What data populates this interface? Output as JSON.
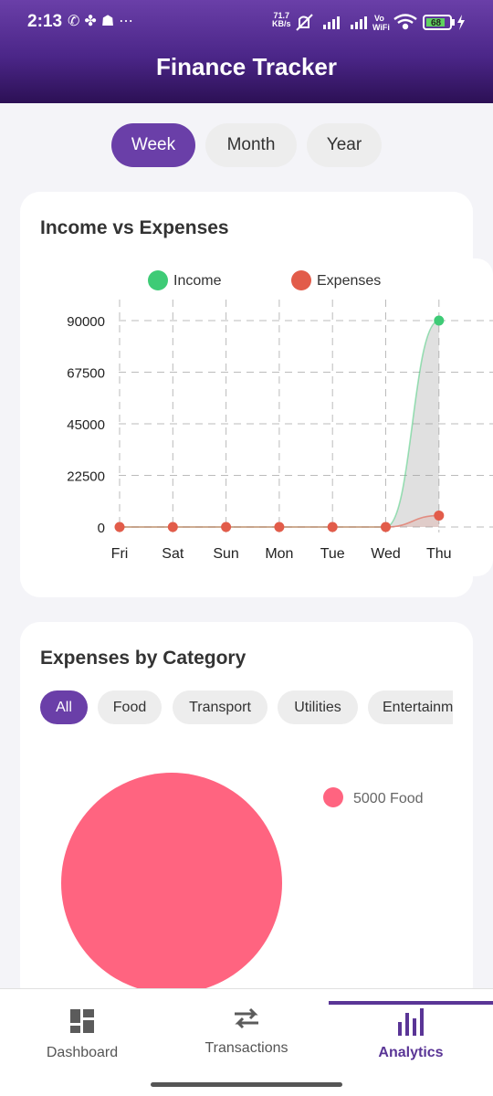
{
  "status_bar": {
    "time": "2:13",
    "left_icons": [
      "whatsapp-icon",
      "pinwheel-icon",
      "snapchat-icon",
      "more-dots-icon"
    ],
    "net_speed_value": "71.7",
    "net_speed_unit": "KB/s",
    "wifi_label": "Vo WiFi",
    "battery_level": "68"
  },
  "header": {
    "title": "Finance Tracker"
  },
  "period_tabs": [
    {
      "label": "Week",
      "active": true
    },
    {
      "label": "Month",
      "active": false
    },
    {
      "label": "Year",
      "active": false
    }
  ],
  "income_chart": {
    "title": "Income vs Expenses",
    "legend": [
      {
        "label": "Income",
        "color": "#3ecb76"
      },
      {
        "label": "Expenses",
        "color": "#e25c4a"
      }
    ]
  },
  "chart_data": [
    {
      "type": "area",
      "title": "Income vs Expenses",
      "categories": [
        "Fri",
        "Sat",
        "Sun",
        "Mon",
        "Tue",
        "Wed",
        "Thu"
      ],
      "y_ticks": [
        "90000",
        "67500",
        "45000",
        "22500",
        "0"
      ],
      "ylim": [
        0,
        90000
      ],
      "grid": true,
      "legend_position": "top",
      "series": [
        {
          "name": "Income",
          "color": "#3ecb76",
          "values": [
            0,
            0,
            0,
            0,
            0,
            0,
            90000
          ]
        },
        {
          "name": "Expenses",
          "color": "#e25c4a",
          "values": [
            0,
            0,
            0,
            0,
            0,
            0,
            5000
          ]
        }
      ]
    },
    {
      "type": "pie",
      "title": "Expenses by Category",
      "categories": [
        "Food"
      ],
      "values": [
        5000
      ],
      "colors": [
        "#ff6480"
      ],
      "legend_labels": [
        "5000 Food"
      ],
      "legend_position": "right"
    }
  ],
  "category_section": {
    "title": "Expenses by Category",
    "chips": [
      {
        "label": "All",
        "active": true
      },
      {
        "label": "Food",
        "active": false
      },
      {
        "label": "Transport",
        "active": false
      },
      {
        "label": "Utilities",
        "active": false
      },
      {
        "label": "Entertainment",
        "active": false
      }
    ]
  },
  "bottom_nav": {
    "items": [
      {
        "label": "Dashboard",
        "icon": "dashboard-icon",
        "active": false
      },
      {
        "label": "Transactions",
        "icon": "transactions-icon",
        "active": false
      },
      {
        "label": "Analytics",
        "icon": "analytics-icon",
        "active": true
      }
    ]
  }
}
